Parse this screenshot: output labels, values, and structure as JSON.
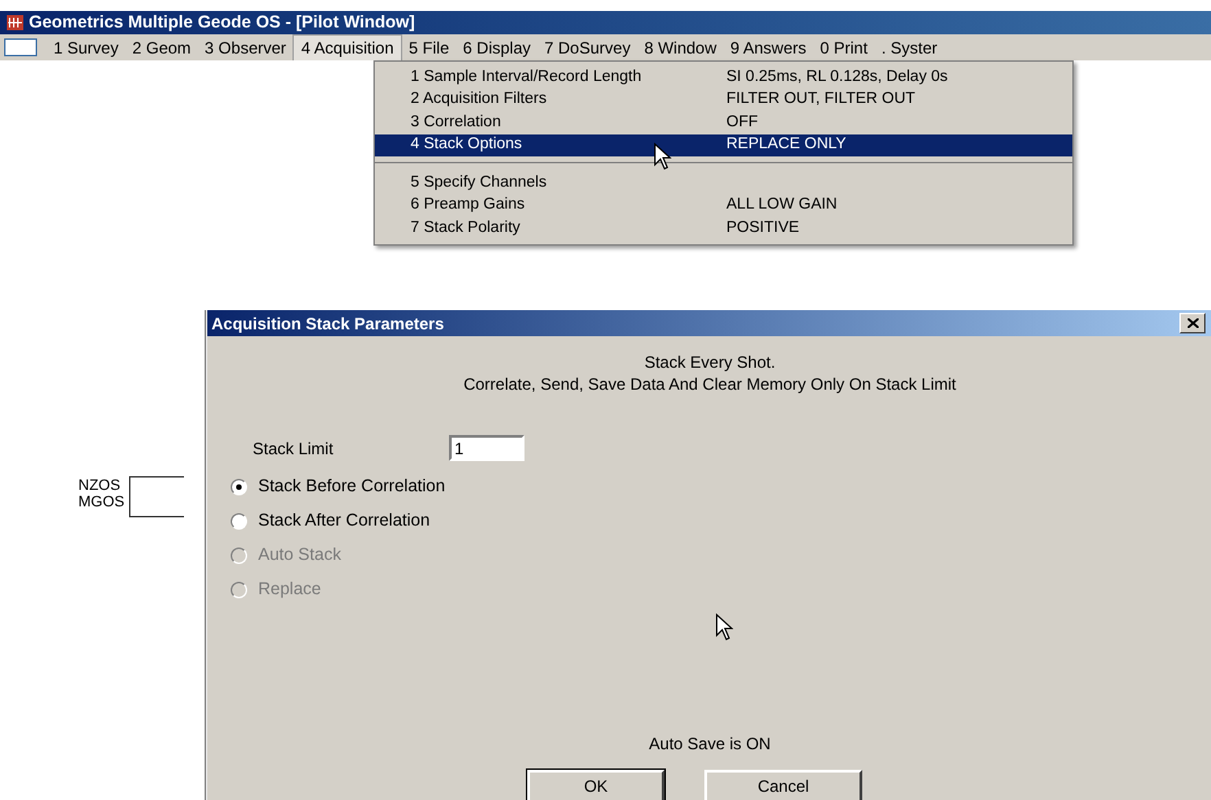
{
  "window": {
    "title": "Geometrics Multiple Geode OS - [Pilot Window]"
  },
  "menu_bar": [
    {
      "label": "1 Survey",
      "selected": false
    },
    {
      "label": "2 Geom",
      "selected": false
    },
    {
      "label": "3 Observer",
      "selected": false
    },
    {
      "label": "4 Acquisition",
      "selected": true
    },
    {
      "label": "5 File",
      "selected": false
    },
    {
      "label": "6 Display",
      "selected": false
    },
    {
      "label": "7 DoSurvey",
      "selected": false
    },
    {
      "label": "8 Window",
      "selected": false
    },
    {
      "label": "9 Answers",
      "selected": false
    },
    {
      "label": "0 Print",
      "selected": false
    },
    {
      "label": ". Syster",
      "selected": false
    }
  ],
  "dropdown": {
    "groups": [
      [
        {
          "label": "1 Sample Interval/Record Length",
          "value": "SI 0.25ms, RL 0.128s, Delay 0s",
          "selected": false
        },
        {
          "label": "2 Acquisition Filters",
          "value": "FILTER OUT, FILTER OUT",
          "selected": false
        },
        {
          "label": "3 Correlation",
          "value": "OFF",
          "selected": false
        },
        {
          "label": "4 Stack Options",
          "value": "REPLACE ONLY",
          "selected": true
        }
      ],
      [
        {
          "label": "5 Specify Channels",
          "selected": false
        },
        {
          "label": "6 Preamp Gains",
          "value": "ALL LOW GAIN",
          "selected": false
        },
        {
          "label": "7 Stack Polarity",
          "value": "POSITIVE",
          "selected": false
        }
      ]
    ]
  },
  "annotation": {
    "lines": [
      "NZOS",
      "MGOS"
    ]
  },
  "dialog": {
    "title": "Acquisition Stack Parameters",
    "message": [
      "Stack Every Shot.",
      "Correlate, Send, Save Data And Clear Memory Only On Stack Limit"
    ],
    "stack_limit": {
      "label": "Stack Limit",
      "value": "1"
    },
    "options": [
      {
        "label": "Stack Before Correlation",
        "selected": true,
        "disabled": false
      },
      {
        "label": "Stack After Correlation",
        "selected": false,
        "disabled": false
      },
      {
        "label": "Auto Stack",
        "selected": false,
        "disabled": true
      },
      {
        "label": "Replace",
        "selected": false,
        "disabled": true
      }
    ],
    "status": "Auto Save is ON",
    "buttons": [
      {
        "label": "OK",
        "default": true
      },
      {
        "label": "Cancel",
        "default": false
      }
    ]
  }
}
